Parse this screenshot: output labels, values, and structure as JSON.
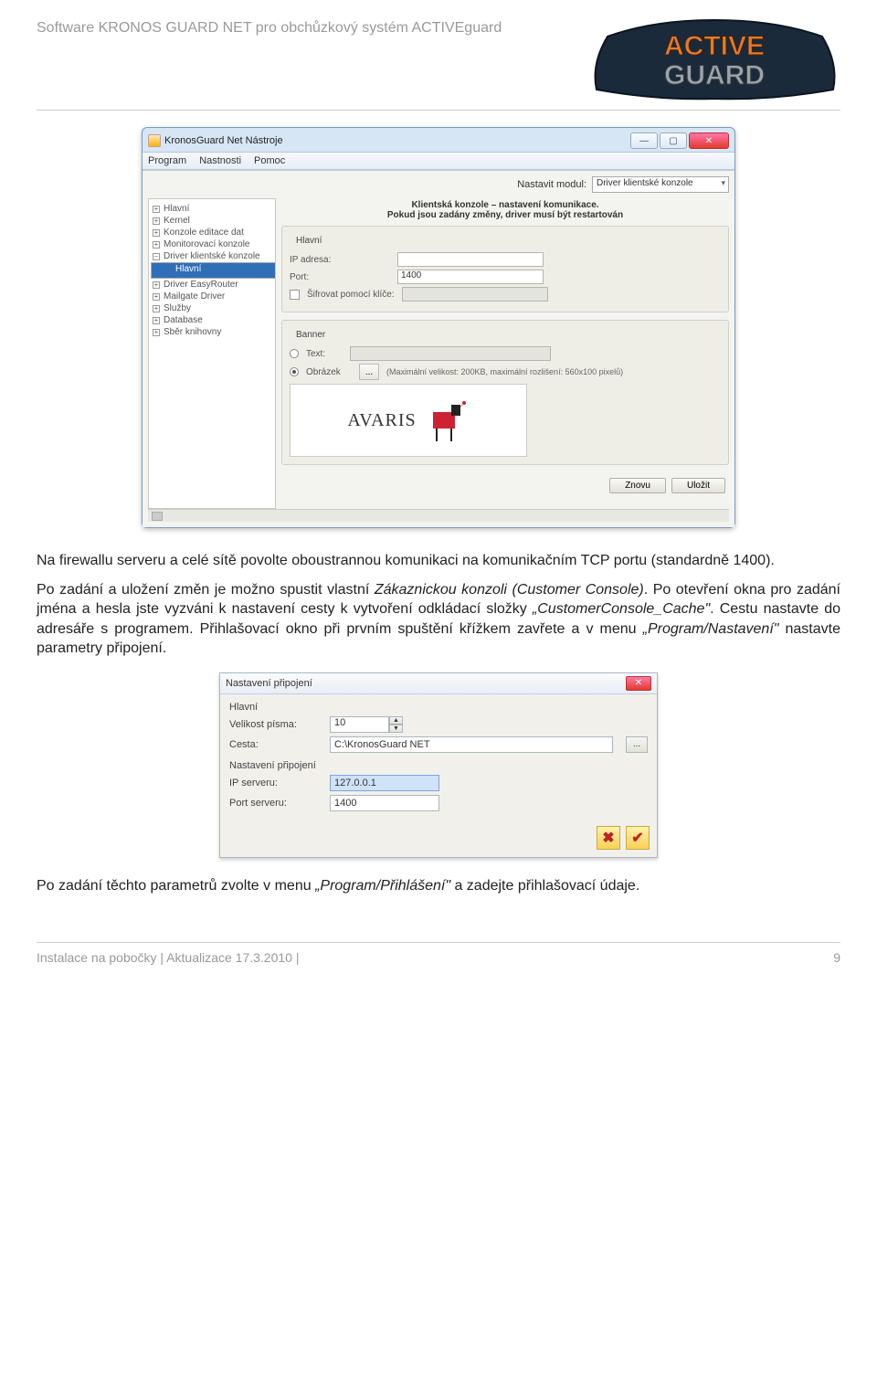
{
  "header": {
    "text": "Software KRONOS GUARD NET pro obchůzkový systém ACTIVEguard"
  },
  "logo": {
    "top": "ACTIVE",
    "bottom": "GUARD"
  },
  "win": {
    "title": "KronosGuard Net Nástroje",
    "menu": [
      "Program",
      "Nastnosti",
      "Pomoc"
    ],
    "modul_label": "Nastavit modul:",
    "modul_value": "Driver klientské konzole",
    "tree": [
      {
        "t": "Hlavní",
        "exp": "+"
      },
      {
        "t": "Kernel",
        "exp": "+"
      },
      {
        "t": "Konzole editace dat",
        "exp": "+"
      },
      {
        "t": "Monitorovací konzole",
        "exp": "+"
      },
      {
        "t": "Driver klientské konzole",
        "exp": "-"
      },
      {
        "t": "Hlavní",
        "sel": true,
        "sub": true
      },
      {
        "t": "Driver EasyRouter",
        "exp": "+"
      },
      {
        "t": "Mailgate Driver",
        "exp": "+"
      },
      {
        "t": "Služby",
        "exp": "+"
      },
      {
        "t": "Database",
        "exp": "+"
      },
      {
        "t": "Sběr knihovny",
        "exp": "+"
      }
    ],
    "msg1": "Klientská konzole – nastavení komunikace.",
    "msg2": "Pokud jsou zadány změny, driver musí být restartován",
    "grp_main": "Hlavní",
    "ip_label": "IP adresa:",
    "port_label": "Port:",
    "port_value": "1400",
    "enc_label": "Šifrovat pomocí klíče:",
    "grp_banner": "Banner",
    "text_label": "Text:",
    "img_label": "Obrázek",
    "img_hint": "(Maximální velikost: 200KB, maximální rozlišení: 560x100 pixelů)",
    "banner_brand": "AVARIS",
    "btn_znovu": "Znovu",
    "btn_ulozit": "Uložit"
  },
  "para1": "Na firewallu serveru a celé sítě povolte oboustrannou komunikaci na komunikačním TCP portu (standardně 1400).",
  "para2_a": "Po zadání a uložení změn je možno spustit vlastní ",
  "para2_b": "Zákaznickou konzoli (Customer Console)",
  "para2_c": ". Po otevření okna pro zadání jména a hesla jste vyzváni k nastavení cesty k vytvoření odkládací složky ",
  "para2_d": "„CustomerConsole_Cache\"",
  "para2_e": ". Cestu nastavte do adresáře s programem. Přihlašovací okno při prvním spuštění křížkem zavřete a v menu ",
  "para2_f": "„Program/Nastavení\"",
  "para2_g": " nastavte parametry připojení.",
  "dlg": {
    "title": "Nastavení připojení",
    "grp_main": "Hlavní",
    "font_label": "Velikost písma:",
    "font_value": "10",
    "path_label": "Cesta:",
    "path_value": "C:\\KronosGuard NET",
    "grp_conn": "Nastavení připojení",
    "ip_label": "IP serveru:",
    "ip_value": "127.0.0.1",
    "port_label": "Port serveru:",
    "port_value": "1400"
  },
  "para3_a": "Po zadání těchto parametrů zvolte v menu ",
  "para3_b": "„Program/Přihlášení\"",
  "para3_c": " a zadejte přihlašovací údaje.",
  "footer": {
    "left": "Instalace na pobočky | Aktualizace 17.3.2010 |",
    "right": "9"
  }
}
